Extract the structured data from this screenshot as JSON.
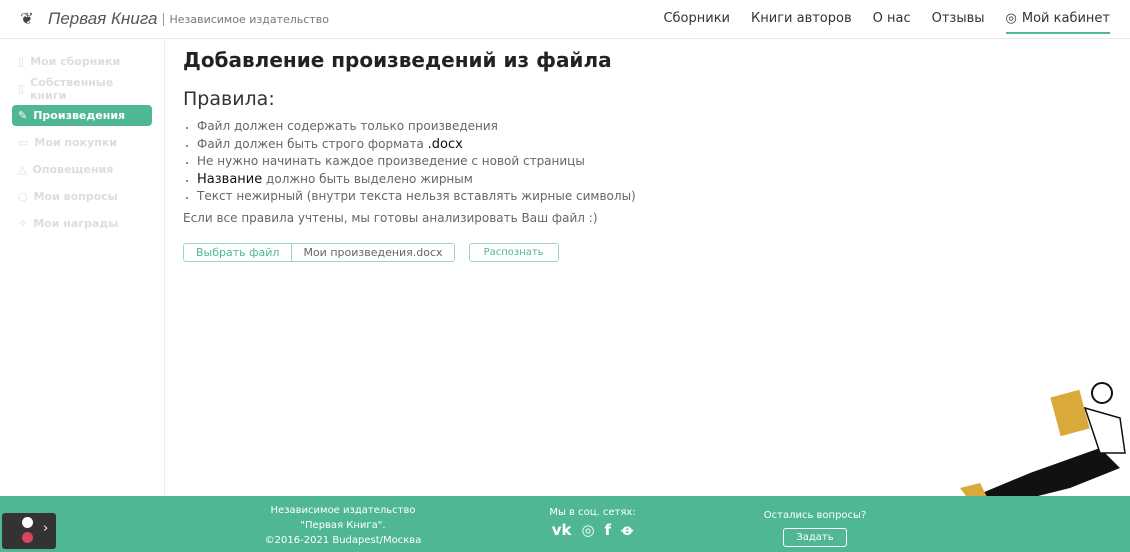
{
  "header": {
    "brand": "Первая Книга",
    "tagline": "Независимое издательство",
    "nav": [
      "Сборники",
      "Книги авторов",
      "О нас",
      "Отзывы"
    ],
    "cabinet": "Мой кабинет"
  },
  "sidebar": {
    "items": [
      {
        "label": "Мои сборники",
        "icon": "book-icon"
      },
      {
        "label": "Собственные книги",
        "icon": "book-icon"
      },
      {
        "label": "Произведения",
        "icon": "feather-icon",
        "active": true
      },
      {
        "label": "Мои покупки",
        "icon": "cart-icon"
      },
      {
        "label": "Оповещения",
        "icon": "bell-icon"
      },
      {
        "label": "Мои вопросы",
        "icon": "chat-icon"
      },
      {
        "label": "Мои награды",
        "icon": "award-icon"
      }
    ]
  },
  "main": {
    "title": "Добавление произведений из файла",
    "rules_title": "Правила:",
    "rules": {
      "r1": "Файл должен содержать только произведения",
      "r2a": "Файл должен быть строго формата ",
      "r2b": ".docx",
      "r3": "Не нужно начинать каждое произведение с новой страницы",
      "r4a": "Название",
      "r4b": " должно быть выделено жирным",
      "r5": "Текст нежирный (внутри текста нельзя вставлять жирные символы)"
    },
    "note": "Если все правила учтены, мы готовы анализировать Ваш файл :)",
    "choose_file": "Выбрать файл",
    "file_name": "Мои произведения.docx",
    "recognize": "Распознать"
  },
  "footer": {
    "l1": "Независимое издательство",
    "l2": "\"Первая Книга\".",
    "l3": "©2016-2021 Budapest/Москва",
    "social_title": "Мы в соц. сетях:",
    "social": [
      "vk-icon",
      "instagram-icon",
      "facebook-icon",
      "odnoklassniki-icon"
    ],
    "questions": "Остались вопросы?",
    "ask": "Задать"
  },
  "colors": {
    "accent": "#4fb893"
  }
}
